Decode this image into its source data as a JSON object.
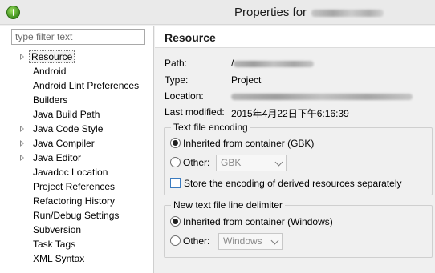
{
  "window": {
    "title": "Properties for"
  },
  "left": {
    "filter_placeholder": "type filter text",
    "items": [
      {
        "label": "Resource",
        "expandable": true,
        "selected": true
      },
      {
        "label": "Android",
        "expandable": false
      },
      {
        "label": "Android Lint Preferences",
        "expandable": false
      },
      {
        "label": "Builders",
        "expandable": false
      },
      {
        "label": "Java Build Path",
        "expandable": false
      },
      {
        "label": "Java Code Style",
        "expandable": true
      },
      {
        "label": "Java Compiler",
        "expandable": true
      },
      {
        "label": "Java Editor",
        "expandable": true
      },
      {
        "label": "Javadoc Location",
        "expandable": false
      },
      {
        "label": "Project References",
        "expandable": false
      },
      {
        "label": "Refactoring History",
        "expandable": false
      },
      {
        "label": "Run/Debug Settings",
        "expandable": false
      },
      {
        "label": "Subversion",
        "expandable": false
      },
      {
        "label": "Task Tags",
        "expandable": false
      },
      {
        "label": "XML Syntax",
        "expandable": false
      }
    ]
  },
  "resource": {
    "title": "Resource",
    "path_label": "Path:",
    "path_value": "/",
    "type_label": "Type:",
    "type_value": "Project",
    "location_label": "Location:",
    "modified_label": "Last modified:",
    "modified_value": "2015年4月22日下午6:16:39",
    "encoding": {
      "legend": "Text file encoding",
      "inherited_label": "Inherited from container (GBK)",
      "other_label": "Other:",
      "other_value": "GBK",
      "store_label": "Store the encoding of derived resources separately"
    },
    "delimiter": {
      "legend": "New text file line delimiter",
      "inherited_label": "Inherited from container (Windows)",
      "other_label": "Other:",
      "other_value": "Windows"
    }
  }
}
